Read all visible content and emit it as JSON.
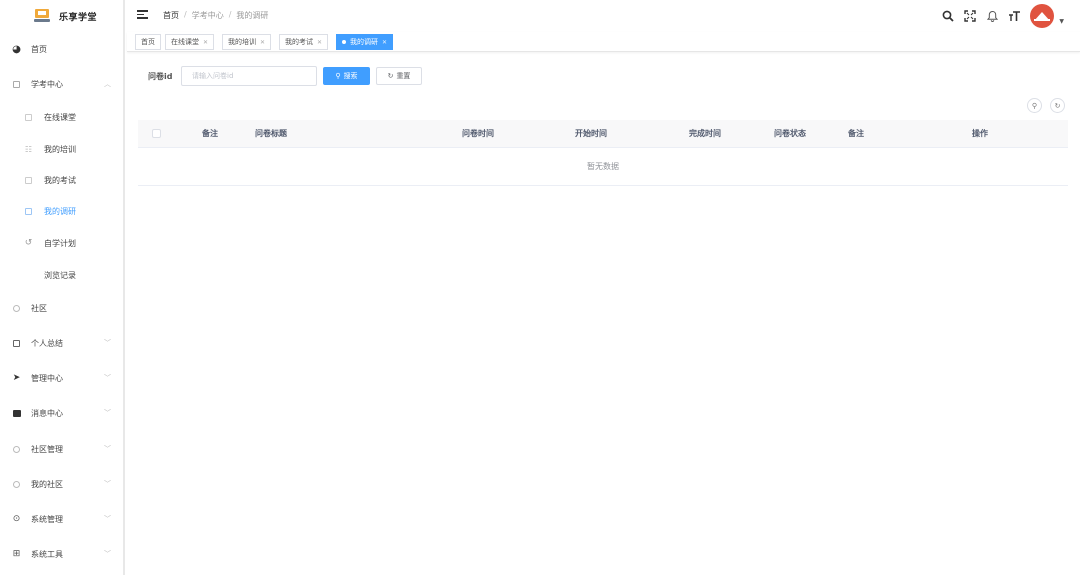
{
  "app": {
    "title": "乐享学堂"
  },
  "sidebar": {
    "items": [
      {
        "label": "首页",
        "icon": "dashboard-icon"
      },
      {
        "label": "学考中心",
        "icon": "monitor-icon",
        "expanded": true
      },
      {
        "label": "在线课堂",
        "icon": "course-icon"
      },
      {
        "label": "我的培训",
        "icon": "training-icon"
      },
      {
        "label": "我的考试",
        "icon": "exam-icon"
      },
      {
        "label": "我的调研",
        "icon": "survey-icon",
        "active": true
      },
      {
        "label": "自学计划",
        "icon": "plan-icon"
      },
      {
        "label": "浏览记录",
        "icon": ""
      },
      {
        "label": "社区",
        "icon": "community-icon"
      },
      {
        "label": "个人总结",
        "icon": "summary-icon"
      },
      {
        "label": "管理中心",
        "icon": "send-icon"
      },
      {
        "label": "消息中心",
        "icon": "message-icon"
      },
      {
        "label": "社区管理",
        "icon": "community-manage-icon"
      },
      {
        "label": "我的社区",
        "icon": "my-community-icon"
      },
      {
        "label": "系统管理",
        "icon": "system-icon"
      },
      {
        "label": "系统工具",
        "icon": "tools-icon"
      }
    ]
  },
  "header": {
    "breadcrumb": [
      "首页",
      "学考中心",
      "我的调研"
    ]
  },
  "tags": [
    {
      "label": "首页",
      "closable": false
    },
    {
      "label": "在线课堂",
      "closable": true
    },
    {
      "label": "我的培训",
      "closable": true
    },
    {
      "label": "我的考试",
      "closable": true
    },
    {
      "label": "我的调研",
      "closable": true,
      "active": true
    }
  ],
  "search": {
    "label": "问卷id",
    "placeholder": "请输入问卷id",
    "value": "",
    "search_button": "搜索",
    "reset_button": "重置"
  },
  "table": {
    "columns": [
      "备注",
      "问卷标题",
      "问卷时间",
      "开始时间",
      "完成时间",
      "问卷状态",
      "备注",
      "操作"
    ],
    "rows": [],
    "empty_text": "暂无数据"
  },
  "colors": {
    "primary": "#409eff",
    "avatar": "#e0533f",
    "logo": "#f0a93b"
  }
}
